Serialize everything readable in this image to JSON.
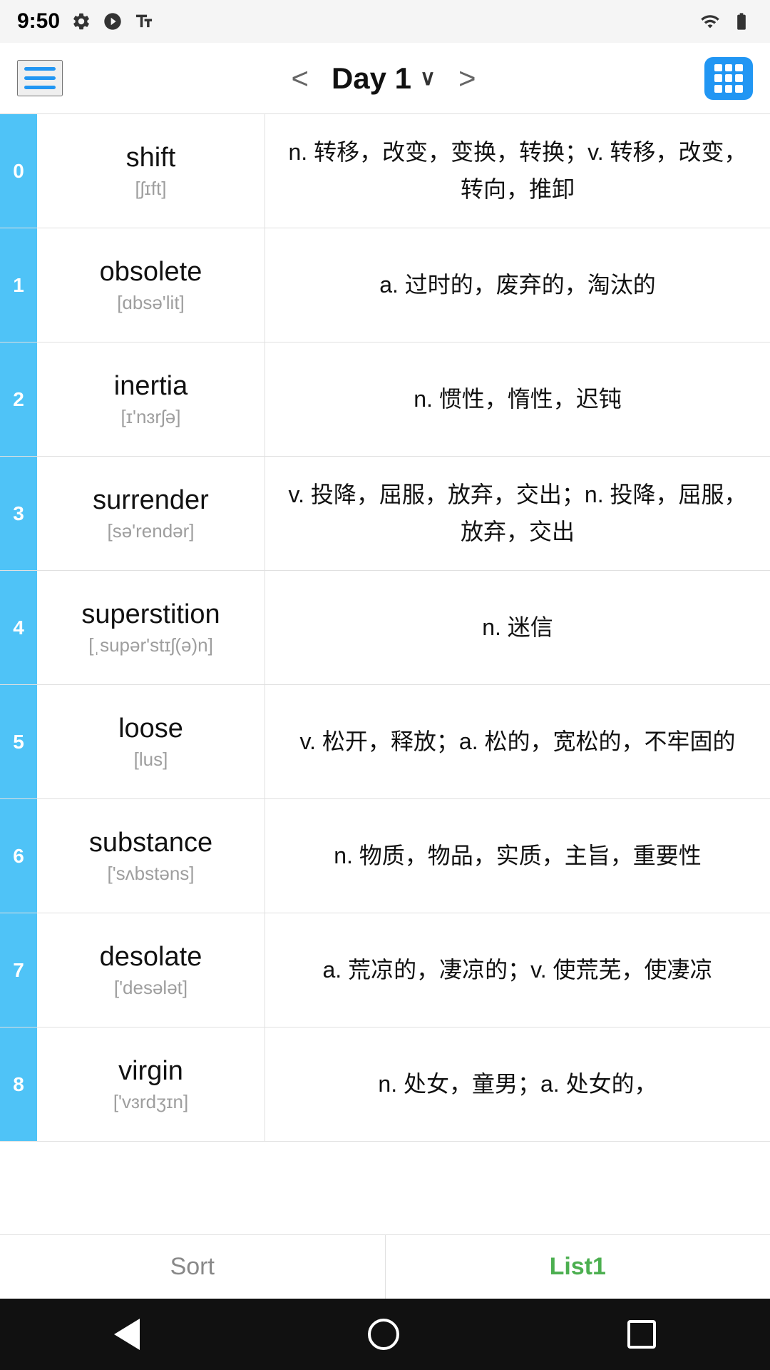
{
  "statusBar": {
    "time": "9:50",
    "icons": [
      "settings",
      "play",
      "text",
      "wifi",
      "signal",
      "battery"
    ]
  },
  "header": {
    "menuLabel": "menu",
    "prevLabel": "<",
    "nextLabel": ">",
    "title": "Day 1",
    "titleChevron": "∨",
    "gridLabel": "grid-view"
  },
  "words": [
    {
      "index": "0",
      "word": "shift",
      "phonetic": "[ʃɪft]",
      "definition": "n. 转移，改变，变换，转换；v. 转移，改变，转向，推卸"
    },
    {
      "index": "1",
      "word": "obsolete",
      "phonetic": "[ɑbsə'lit]",
      "definition": "a. 过时的，废弃的，淘汰的"
    },
    {
      "index": "2",
      "word": "inertia",
      "phonetic": "[ɪ'nɜrʃə]",
      "definition": "n. 惯性，惰性，迟钝"
    },
    {
      "index": "3",
      "word": "surrender",
      "phonetic": "[sə'rendər]",
      "definition": "v. 投降，屈服，放弃，交出；n. 投降，屈服，放弃，交出"
    },
    {
      "index": "4",
      "word": "superstition",
      "phonetic": "[ˌsupər'stɪʃ(ə)n]",
      "definition": "n. 迷信"
    },
    {
      "index": "5",
      "word": "loose",
      "phonetic": "[lus]",
      "definition": "v. 松开，释放；a. 松的，宽松的，不牢固的"
    },
    {
      "index": "6",
      "word": "substance",
      "phonetic": "['sʌbstəns]",
      "definition": "n. 物质，物品，实质，主旨，重要性"
    },
    {
      "index": "7",
      "word": "desolate",
      "phonetic": "['desələt]",
      "definition": "a. 荒凉的，凄凉的；v. 使荒芜，使凄凉"
    },
    {
      "index": "8",
      "word": "virgin",
      "phonetic": "['vɜrdʒɪn]",
      "definition": "n. 处女，童男；a. 处女的，"
    }
  ],
  "bottomTabs": {
    "sort": "Sort",
    "list1": "List1"
  },
  "androidNav": {
    "back": "back",
    "home": "home",
    "recent": "recent"
  }
}
